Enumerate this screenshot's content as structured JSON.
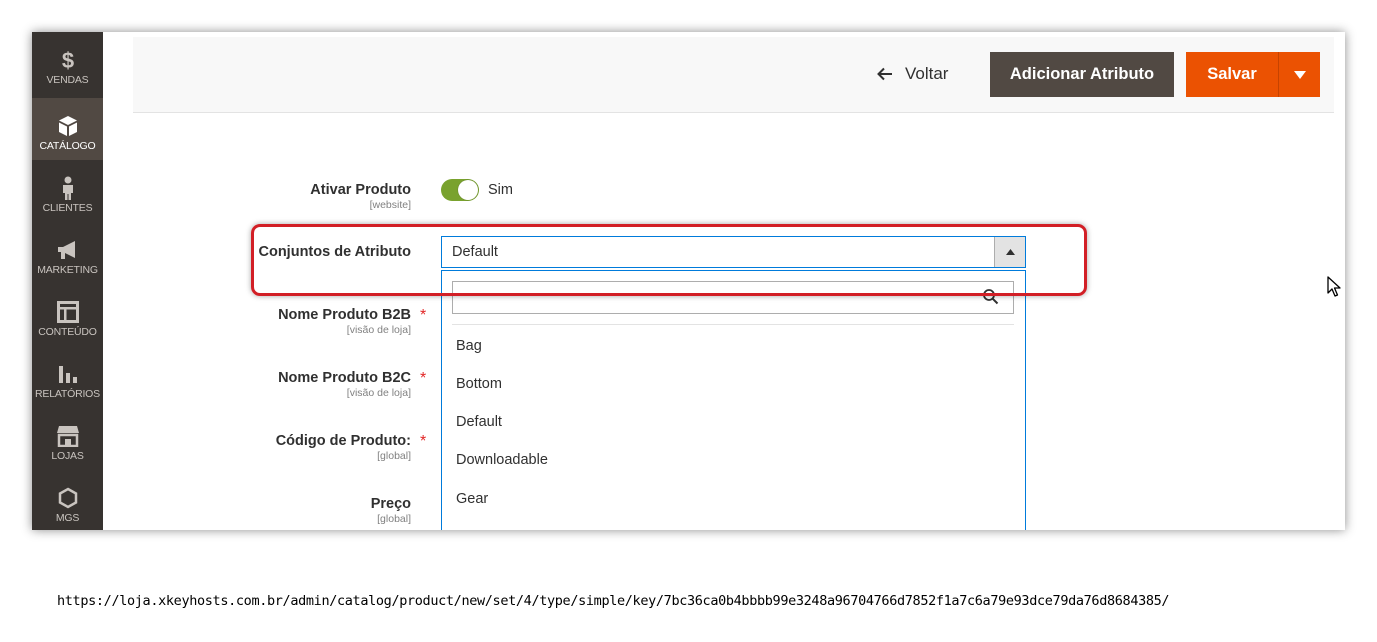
{
  "sidebar": {
    "items": [
      {
        "label": "VENDAS",
        "icon": "dollar-icon"
      },
      {
        "label": "CATÁLOGO",
        "icon": "cube-icon"
      },
      {
        "label": "CLIENTES",
        "icon": "person-icon"
      },
      {
        "label": "MARKETING",
        "icon": "megaphone-icon"
      },
      {
        "label": "CONTEÚDO",
        "icon": "layout-icon"
      },
      {
        "label": "RELATÓRIOS",
        "icon": "bar-chart-icon"
      },
      {
        "label": "LOJAS",
        "icon": "storefront-icon"
      },
      {
        "label": "MGS",
        "icon": "hexagon-icon"
      }
    ],
    "active": "CATÁLOGO"
  },
  "actions": {
    "back_label": "Voltar",
    "add_attribute_label": "Adicionar Atributo",
    "save_label": "Salvar"
  },
  "form": {
    "enable_product": {
      "label": "Ativar Produto",
      "scope": "[website]",
      "value_text": "Sim",
      "enabled": true
    },
    "attribute_set": {
      "label": "Conjuntos de Atributo",
      "value": "Default"
    },
    "name_b2b": {
      "label": "Nome Produto B2B",
      "scope": "[visão de loja]",
      "required": "*"
    },
    "name_b2c": {
      "label": "Nome Produto B2C",
      "scope": "[visão de loja]",
      "required": "*"
    },
    "sku": {
      "label": "Código de Produto:",
      "scope": "[global]",
      "required": "*"
    },
    "price": {
      "label": "Preço",
      "scope": "[global]"
    }
  },
  "dropdown": {
    "search_placeholder": "",
    "options": [
      "Bag",
      "Bottom",
      "Default",
      "Downloadable",
      "Gear"
    ]
  },
  "url": "https://loja.xkeyhosts.com.br/admin/catalog/product/new/set/4/type/simple/key/7bc36ca0b4bbbb99e3248a96704766d7852f1a7c6a79e93dce79da76d8684385/",
  "colors": {
    "accent": "#eb5202",
    "sidebar": "#373330",
    "toggle_on": "#79a22e",
    "focus": "#007bdb",
    "highlight": "#d21f26"
  }
}
